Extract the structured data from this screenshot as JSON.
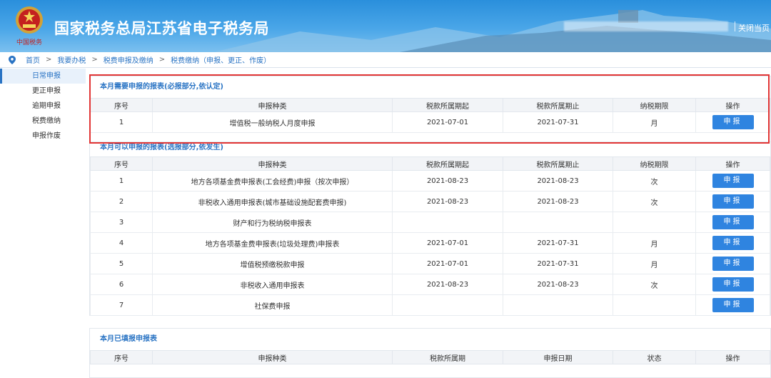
{
  "header": {
    "site_title": "国家税务总局江苏省电子税务局",
    "logo_caption": "中国税务",
    "close_label": "关闭当页"
  },
  "breadcrumb": [
    "首页",
    "我要办税",
    "税费申报及缴纳",
    "税费缴纳（申报、更正、作废）"
  ],
  "sidebar": {
    "items": [
      {
        "label": "日常申报",
        "active": true
      },
      {
        "label": "更正申报",
        "active": false
      },
      {
        "label": "逾期申报",
        "active": false
      },
      {
        "label": "税费缴纳",
        "active": false
      },
      {
        "label": "申报作废",
        "active": false
      }
    ]
  },
  "required": {
    "title": "本月需要申报的报表(必报部分,依认定)",
    "columns": [
      "序号",
      "申报种类",
      "税款所属期起",
      "税款所属期止",
      "纳税期限",
      "操作"
    ],
    "rows": [
      {
        "no": "1",
        "type": "增值税一般纳税人月度申报",
        "start": "2021-07-01",
        "end": "2021-07-31",
        "period": "月",
        "action": "申报"
      }
    ]
  },
  "optional": {
    "title": "本月可以申报的报表(选报部分,依发生)",
    "columns": [
      "序号",
      "申报种类",
      "税款所属期起",
      "税款所属期止",
      "纳税期限",
      "操作"
    ],
    "rows": [
      {
        "no": "1",
        "type": "地方各项基金费申报表(工会经费)申报（按次申报）",
        "start": "2021-08-23",
        "end": "2021-08-23",
        "period": "次",
        "action": "申报"
      },
      {
        "no": "2",
        "type": "非税收入通用申报表(城市基础设施配套费申报)",
        "start": "2021-08-23",
        "end": "2021-08-23",
        "period": "次",
        "action": "申报"
      },
      {
        "no": "3",
        "type": "财产和行为税纳税申报表",
        "start": "",
        "end": "",
        "period": "",
        "action": "申报"
      },
      {
        "no": "4",
        "type": "地方各项基金费申报表(垃圾处理费)申报表",
        "start": "2021-07-01",
        "end": "2021-07-31",
        "period": "月",
        "action": "申报"
      },
      {
        "no": "5",
        "type": "增值税预缴税款申报",
        "start": "2021-07-01",
        "end": "2021-07-31",
        "period": "月",
        "action": "申报"
      },
      {
        "no": "6",
        "type": "非税收入通用申报表",
        "start": "2021-08-23",
        "end": "2021-08-23",
        "period": "次",
        "action": "申报"
      },
      {
        "no": "7",
        "type": "社保费申报",
        "start": "",
        "end": "",
        "period": "",
        "action": "申报"
      }
    ]
  },
  "filed": {
    "title": "本月已填报申报表",
    "columns": [
      "序号",
      "申报种类",
      "税款所属期",
      "申报日期",
      "状态",
      "操作"
    ]
  },
  "colors": {
    "accent": "#2a74c4",
    "button": "#2f84e0",
    "highlight": "#e23535"
  }
}
